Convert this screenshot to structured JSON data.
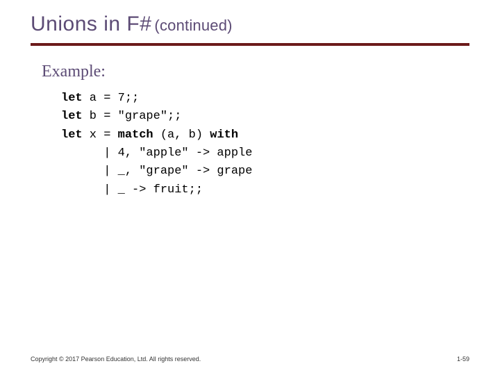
{
  "title": {
    "main": "Unions in F#",
    "sub": "(continued)"
  },
  "example_label": "Example:",
  "code": {
    "kw_let": "let",
    "kw_match": "match",
    "kw_with": "with",
    "line1_rest": " a = 7;;",
    "line2_rest": " b = \"grape\";;",
    "line3_mid": " x = ",
    "line3_paren": " (a, b) ",
    "line4": "      | 4, \"apple\" -> apple",
    "line5": "      | _, \"grape\" -> grape",
    "line6": "      | _ -> fruit;;"
  },
  "footer": {
    "copyright": "Copyright © 2017 Pearson Education, Ltd. All rights reserved.",
    "page": "1-59"
  }
}
